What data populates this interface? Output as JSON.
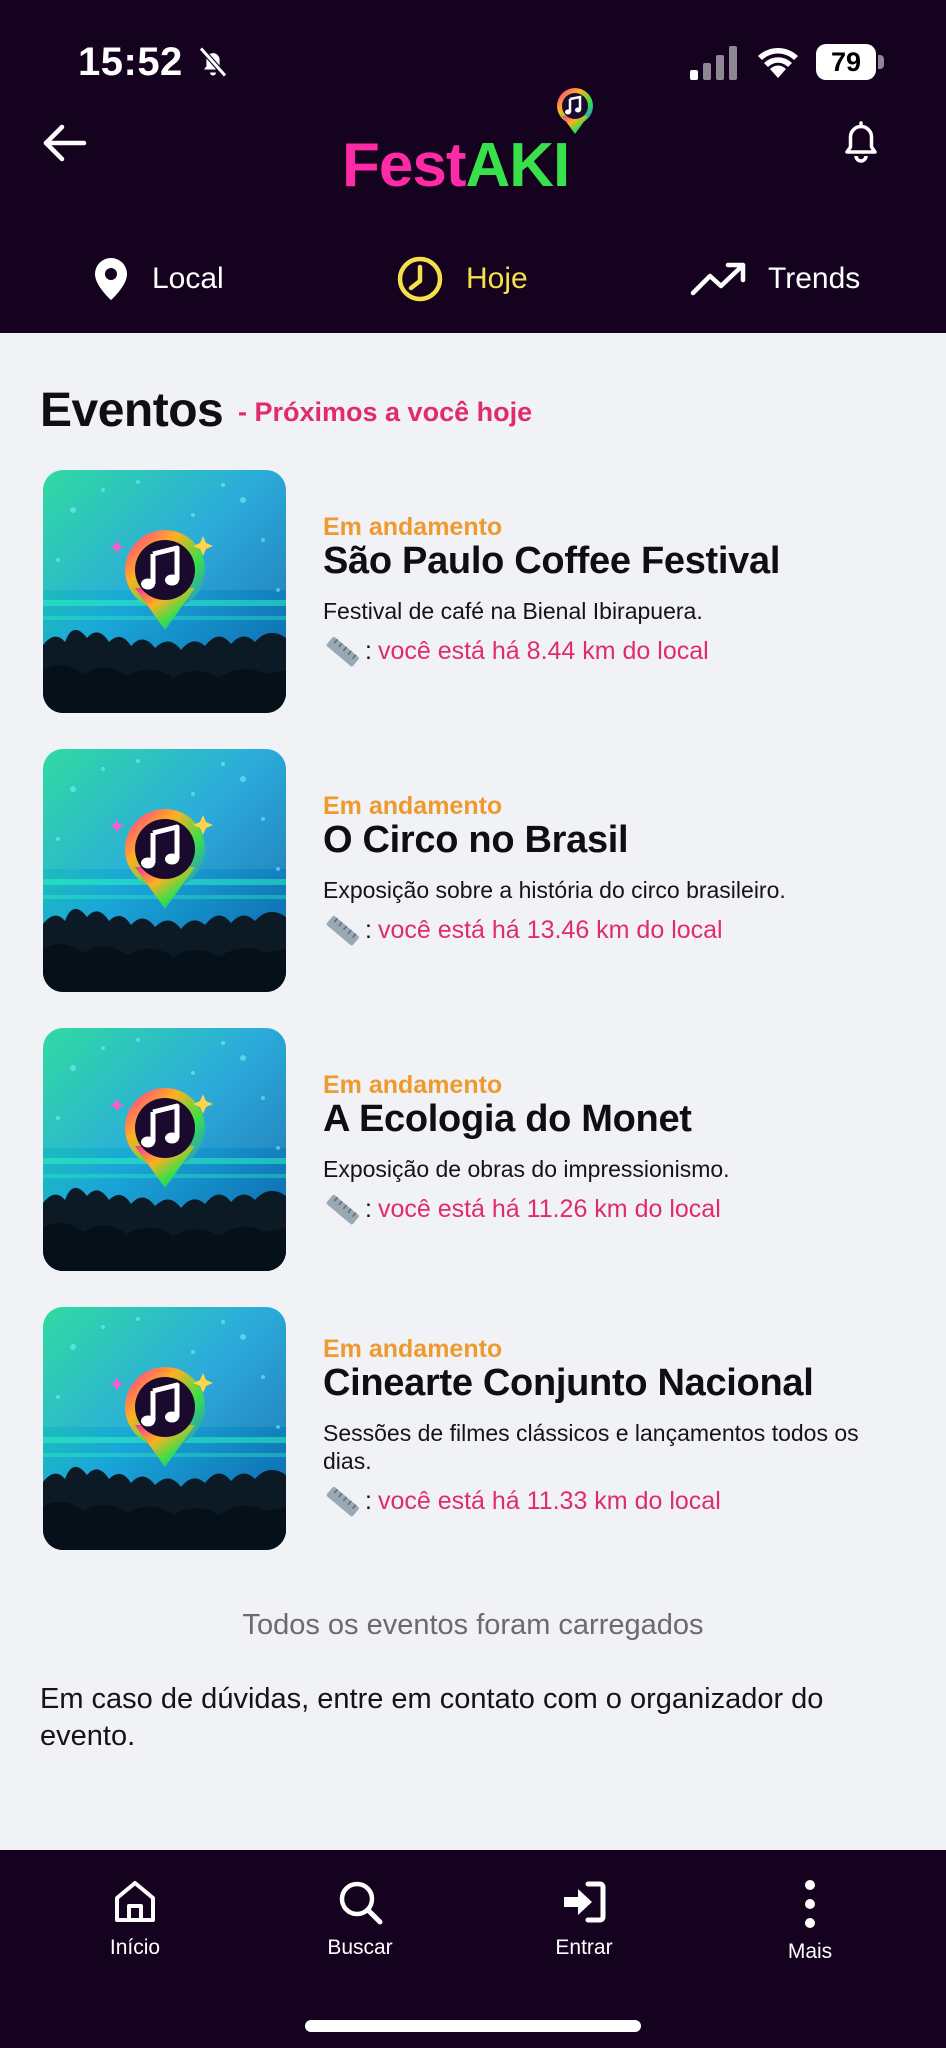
{
  "status_bar": {
    "time": "15:52",
    "battery": "79"
  },
  "header": {
    "logo": {
      "part1": "Fest",
      "part2": "AKI",
      "accent_pink": "#ff2aa6",
      "accent_green": "#38e04a"
    },
    "tabs": [
      {
        "label": "Local",
        "icon": "location-pin-icon"
      },
      {
        "label": "Hoje",
        "icon": "clock-icon",
        "active": true
      },
      {
        "label": "Trends",
        "icon": "trending-up-icon"
      }
    ]
  },
  "section": {
    "title": "Eventos",
    "subtitle": "- Próximos a você hoje"
  },
  "events": [
    {
      "status": "Em andamento",
      "title": "São Paulo Coffee Festival",
      "description": "Festival de café na Bienal Ibirapuera.",
      "distance": "você está há 8.44 km do local"
    },
    {
      "status": "Em andamento",
      "title": "O Circo no Brasil",
      "description": "Exposição sobre a história do circo brasileiro.",
      "distance": "você está há 13.46 km do local"
    },
    {
      "status": "Em andamento",
      "title": "A Ecologia do Monet",
      "description": "Exposição de obras do impressionismo.",
      "distance": "você está há 11.26 km do local"
    },
    {
      "status": "Em andamento",
      "title": "Cinearte Conjunto Nacional",
      "description": "Sessões de filmes clássicos e lançamentos todos os dias.",
      "distance": "você está há 11.33 km do local"
    }
  ],
  "footer": {
    "loaded_message": "Todos os eventos foram carregados",
    "contact_message": "Em caso de dúvidas, entre em contato com o organizador do evento."
  },
  "bottom_nav": [
    {
      "label": "Início",
      "icon": "home-icon"
    },
    {
      "label": "Buscar",
      "icon": "search-icon"
    },
    {
      "label": "Entrar",
      "icon": "login-icon"
    },
    {
      "label": "Mais",
      "icon": "more-vertical-icon"
    }
  ],
  "colors": {
    "header_bg": "#14021f",
    "status_orange": "#ee9a2e",
    "accent_pink": "#e02b6f",
    "active_tab": "#f6e04a"
  }
}
